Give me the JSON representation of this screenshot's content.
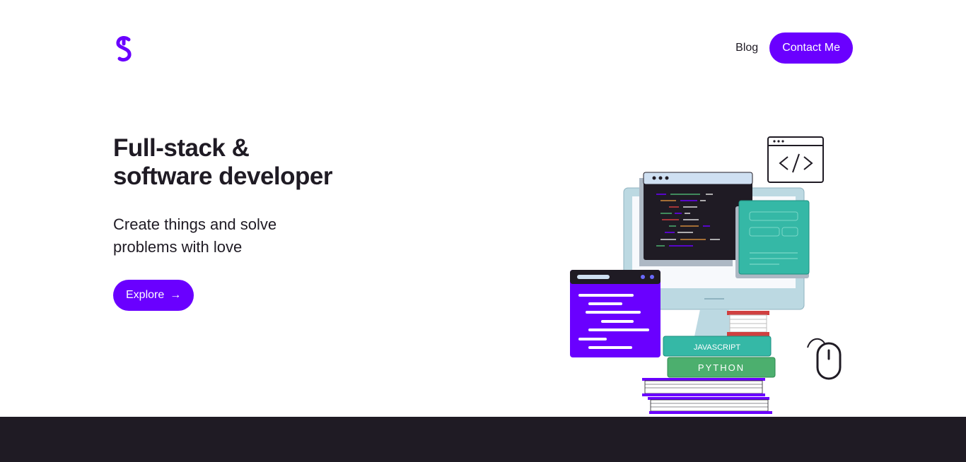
{
  "nav": {
    "blog_label": "Blog",
    "contact_label": "Contact Me"
  },
  "hero": {
    "title_line1": "Full-stack &",
    "title_line2": "software developer",
    "subtitle_line1": "Create things and solve",
    "subtitle_line2": "problems with love",
    "explore_label": "Explore"
  },
  "illustration": {
    "book1_label": "JAVASCRIPT",
    "book2_label": "PYTHON"
  },
  "colors": {
    "accent": "#6a00ff",
    "dark": "#1f1b24",
    "teal": "#35b8a6",
    "green": "#4caf6e",
    "monitor": "#bcd9e2"
  }
}
